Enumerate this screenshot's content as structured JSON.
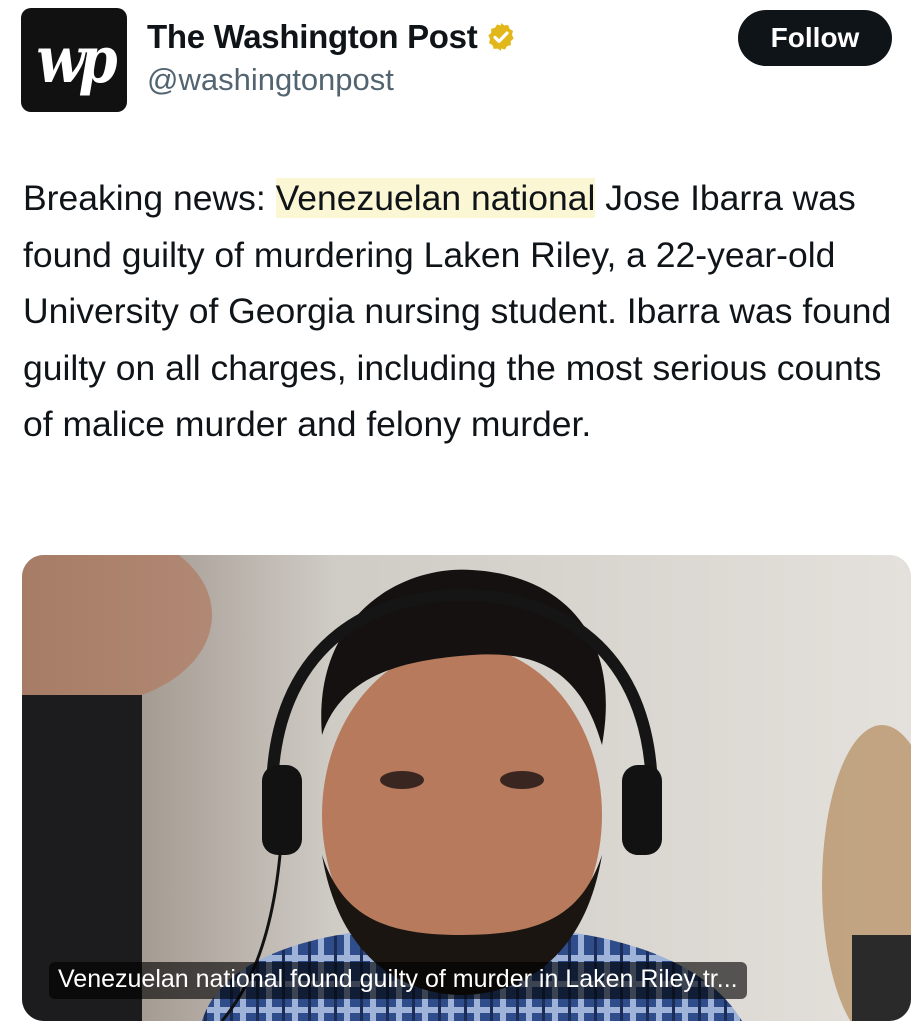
{
  "account": {
    "display_name": "The Washington Post",
    "handle": "@washingtonpost",
    "avatar_text": "wp",
    "verified_icon": "verified-badge-gold"
  },
  "follow_label": "Follow",
  "tweet": {
    "text_before": "Breaking news: ",
    "text_highlight": "Venezuelan national",
    "text_after": " Jose Ibarra was found guilty of murdering Laken Riley, a 22-year-old University of Georgia nursing student. Ibarra was found guilty on all charges, including the most serious counts of malice murder and felony murder."
  },
  "media": {
    "caption": "Venezuelan national found guilty of murder in Laken Riley tr..."
  },
  "colors": {
    "text": "#0f1419",
    "secondary": "#536471",
    "follow_bg": "#0f1419",
    "highlight": "#fbf6d3",
    "badge": "#e2b719"
  }
}
